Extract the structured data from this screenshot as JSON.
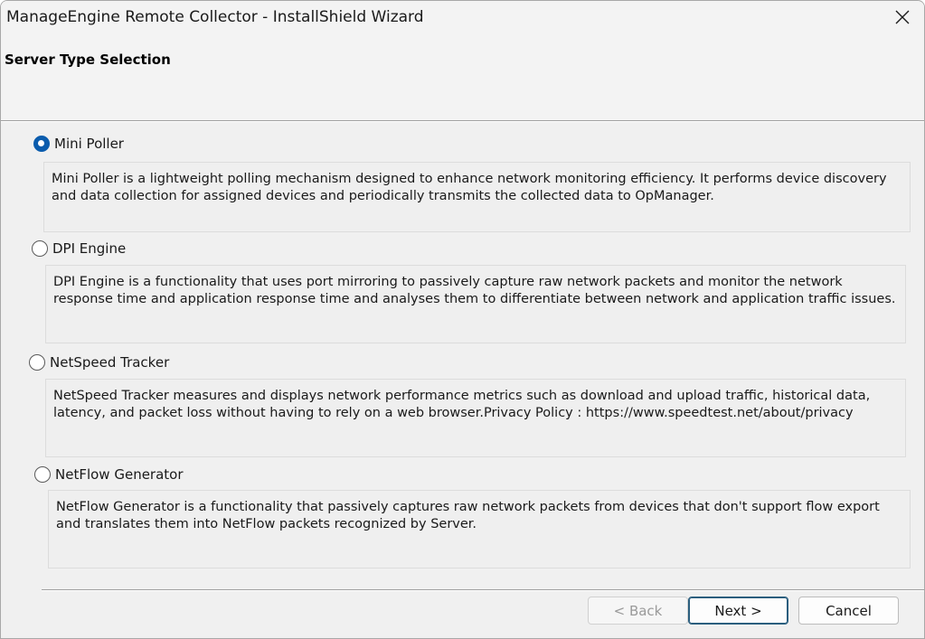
{
  "window": {
    "title": "ManageEngine Remote Collector - InstallShield Wizard"
  },
  "header": {
    "title": "Server Type Selection"
  },
  "options": [
    {
      "label": "Mini Poller",
      "selected": true,
      "description": "Mini Poller is a lightweight polling mechanism designed to enhance network monitoring efficiency. It performs device discovery and data collection for assigned devices and periodically transmits the collected data to OpManager."
    },
    {
      "label": "DPI Engine",
      "selected": false,
      "description": "DPI Engine is a functionality that uses port mirroring to passively capture raw network packets and monitor the network response time and application response time and analyses them to differentiate between network and application traffic issues."
    },
    {
      "label": "NetSpeed Tracker",
      "selected": false,
      "description": "NetSpeed Tracker measures and displays network performance metrics such as download and upload traffic, historical data, latency, and packet loss without having to rely on a web browser.Privacy Policy : https://www.speedtest.net/about/privacy"
    },
    {
      "label": "NetFlow Generator",
      "selected": false,
      "description": "NetFlow Generator is a functionality that passively captures raw network packets from devices that don't support flow export and translates them into NetFlow packets recognized by Server."
    }
  ],
  "buttons": {
    "back_label": "< Back",
    "next_label": "Next >",
    "cancel_label": "Cancel"
  },
  "colors": {
    "accent": "#0b5cad",
    "window_bg": "#f0f0f0"
  },
  "icons": {
    "close": "close-icon"
  }
}
